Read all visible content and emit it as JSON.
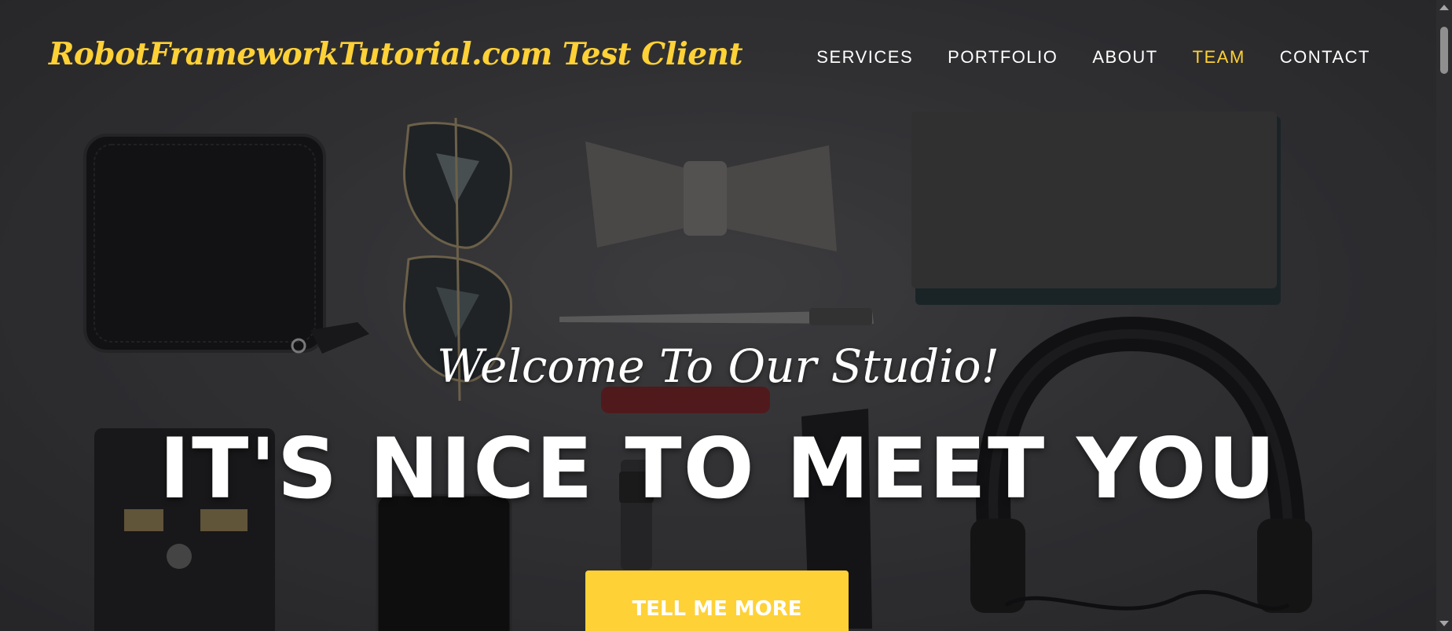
{
  "navbar": {
    "brand": "RobotFrameworkTutorial.com Test Client",
    "items": [
      {
        "label": "SERVICES",
        "active": false
      },
      {
        "label": "PORTFOLIO",
        "active": false
      },
      {
        "label": "ABOUT",
        "active": false
      },
      {
        "label": "TEAM",
        "active": true
      },
      {
        "label": "CONTACT",
        "active": false
      }
    ]
  },
  "hero": {
    "lead_in": "Welcome To Our Studio!",
    "heading": "IT'S NICE TO MEET YOU",
    "cta_label": "TELL ME MORE",
    "background_icons": [
      "wallet-icon",
      "sunglasses-icon",
      "bow-tie-icon",
      "notebook-icon",
      "pen-icon",
      "headphones-icon",
      "card-holder-icon",
      "phone-icon",
      "watch-icon",
      "glasses-icon"
    ]
  },
  "colors": {
    "accent": "#fed136",
    "text": "#ffffff",
    "background": "#3a3a3c"
  }
}
